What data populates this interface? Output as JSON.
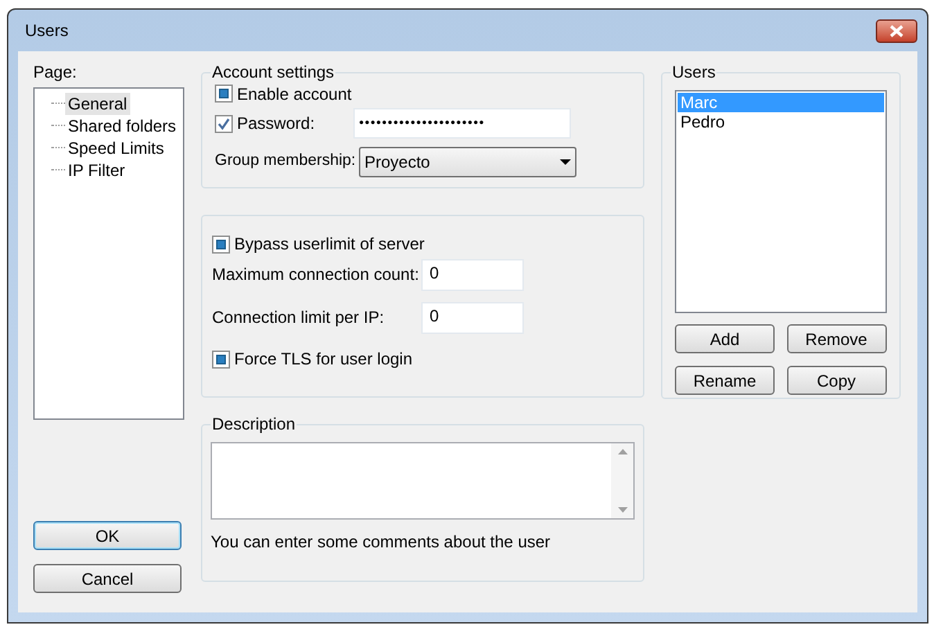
{
  "window": {
    "title": "Users"
  },
  "page_panel": {
    "label": "Page:",
    "items": [
      {
        "label": "General",
        "selected": true
      },
      {
        "label": "Shared folders",
        "selected": false
      },
      {
        "label": "Speed Limits",
        "selected": false
      },
      {
        "label": "IP Filter",
        "selected": false
      }
    ]
  },
  "account_settings": {
    "title": "Account settings",
    "enable_account": {
      "label": "Enable account",
      "indeterminate": true
    },
    "password": {
      "label": "Password:",
      "checked": true,
      "value": "●●●●●●●●●●●●●●●●●●●●●●"
    },
    "group_membership": {
      "label": "Group membership:",
      "value": "Proyecto"
    }
  },
  "limits": {
    "bypass": {
      "label": "Bypass userlimit of server",
      "indeterminate": true
    },
    "max_connections": {
      "label": "Maximum connection count:",
      "value": "0"
    },
    "per_ip": {
      "label": "Connection limit per IP:",
      "value": "0"
    },
    "force_tls": {
      "label": "Force TLS for user login",
      "indeterminate": true
    }
  },
  "description": {
    "title": "Description",
    "hint": "You can enter some comments about the user"
  },
  "users": {
    "title": "Users",
    "items": [
      {
        "name": "Marc",
        "selected": true
      },
      {
        "name": "Pedro",
        "selected": false
      }
    ],
    "buttons": [
      "Add",
      "Remove",
      "Rename",
      "Copy"
    ]
  },
  "buttons": [
    {
      "label": "OK",
      "default": true
    },
    {
      "label": "Cancel",
      "default": false
    }
  ]
}
